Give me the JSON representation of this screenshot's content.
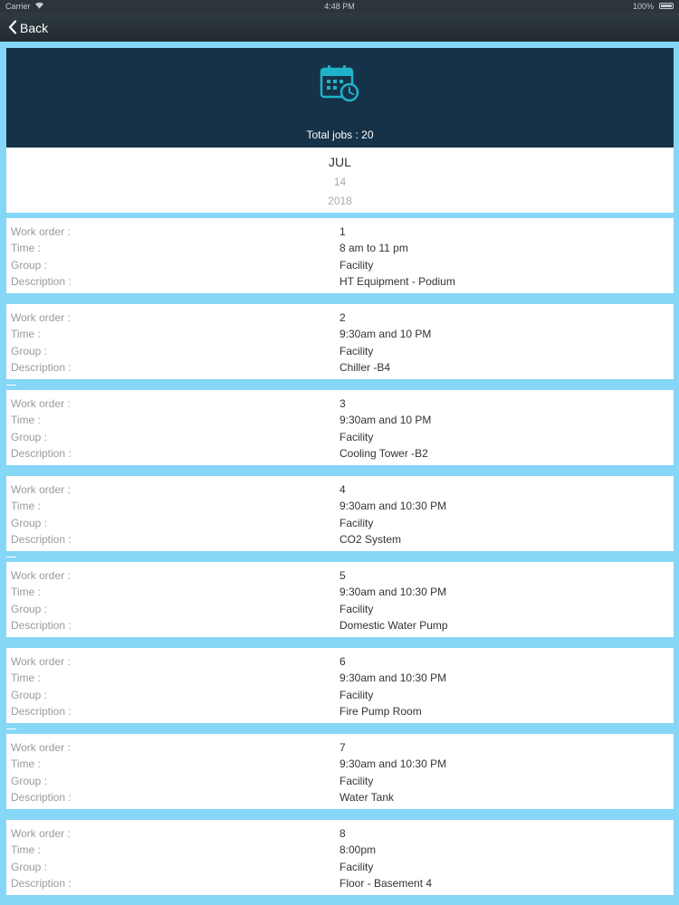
{
  "status_bar": {
    "carrier": "Carrier",
    "time": "4:48 PM",
    "battery": "100%"
  },
  "nav": {
    "back_label": "Back"
  },
  "summary": {
    "total_jobs_label": "Total jobs : 20"
  },
  "date": {
    "month": "JUL",
    "day": "14",
    "year": "2018"
  },
  "labels": {
    "work_order": "Work order :",
    "time": "Time :",
    "group": "Group :",
    "description": "Description :"
  },
  "jobs": [
    {
      "work_order": "1",
      "time": "8 am to 11 pm",
      "group": "Facility",
      "description": "HT Equipment - Podium"
    },
    {
      "work_order": "2",
      "time": "9:30am and 10 PM",
      "group": "Facility",
      "description": "Chiller -B4"
    },
    {
      "work_order": "3",
      "time": "9:30am and 10 PM",
      "group": "Facility",
      "description": "Cooling Tower -B2"
    },
    {
      "work_order": "4",
      "time": "9:30am and 10:30 PM",
      "group": "Facility",
      "description": "CO2 System"
    },
    {
      "work_order": "5",
      "time": "9:30am and 10:30 PM",
      "group": "Facility",
      "description": "Domestic Water Pump"
    },
    {
      "work_order": "6",
      "time": "9:30am and 10:30 PM",
      "group": "Facility",
      "description": "Fire Pump Room"
    },
    {
      "work_order": "7",
      "time": "9:30am and 10:30 PM",
      "group": "Facility",
      "description": "Water Tank"
    },
    {
      "work_order": "8",
      "time": "8:00pm",
      "group": "Facility",
      "description": "Floor - Basement 4"
    }
  ],
  "colors": {
    "background": "#86d6f8",
    "header": "#163248",
    "icon_accent": "#1fb3c9",
    "nav_bar": "#2b353b"
  },
  "icons": {
    "header_icon": "calendar-clock-icon",
    "back_icon": "chevron-left-icon"
  }
}
